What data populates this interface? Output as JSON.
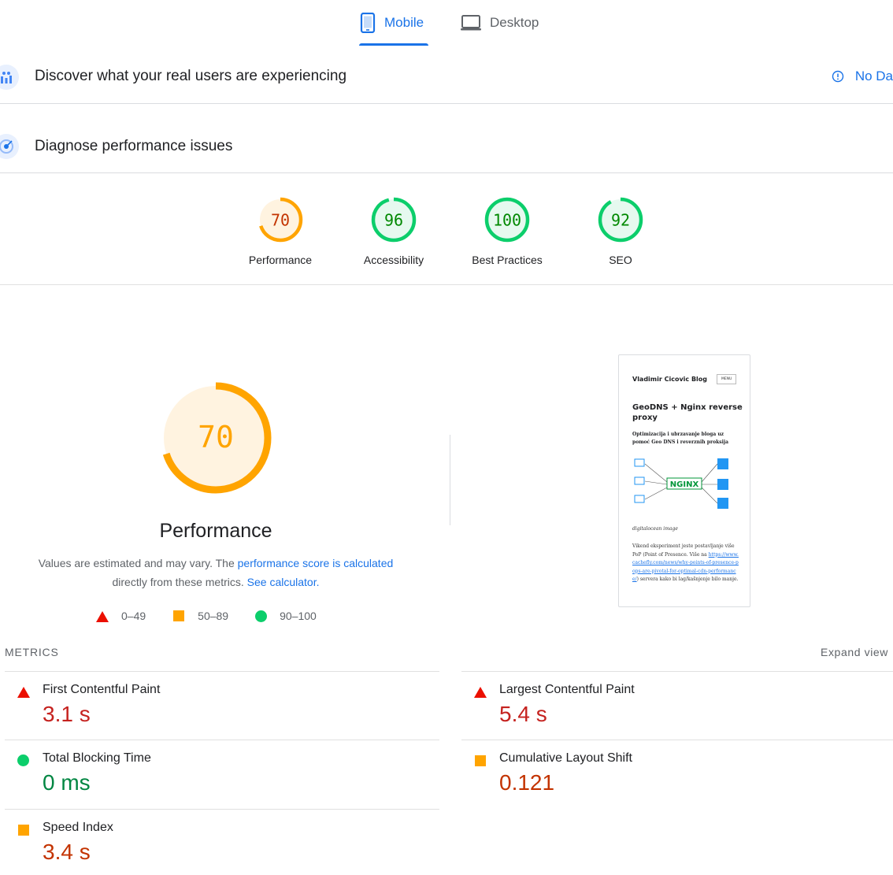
{
  "tabs": {
    "mobile": "Mobile",
    "desktop": "Desktop"
  },
  "sections": {
    "field": "Discover what your real users are experiencing",
    "field_status": "No Da",
    "lab": "Diagnose performance issues"
  },
  "scores": [
    {
      "label": "Performance",
      "value": "70",
      "score": 0.7,
      "color": "#ffa400"
    },
    {
      "label": "Accessibility",
      "value": "96",
      "score": 0.96,
      "color": "#0cce6b"
    },
    {
      "label": "Best Practices",
      "value": "100",
      "score": 1.0,
      "color": "#0cce6b"
    },
    {
      "label": "SEO",
      "value": "92",
      "score": 0.92,
      "color": "#0cce6b"
    }
  ],
  "performance": {
    "value": "70",
    "score": 0.7,
    "title": "Performance",
    "desc_prefix": "Values are estimated and may vary. The",
    "desc_link": "performance score is calculated",
    "desc_middle": "directly from these metrics.",
    "desc_link2": "See calculator."
  },
  "legend": [
    "0–49",
    "50–89",
    "90–100"
  ],
  "screenshot": {
    "blog_name": "Vladimir Cicovic Blog",
    "menu": "MENU",
    "post_title": "GeoDNS + Nginx reverse proxy",
    "post_sub": "Optimizacija i ubrzavanje bloga uz pomoć Geo DNS i reverznih proksija",
    "caption": "digitalocean image",
    "body_a": "Vikend eksperiment jeste postavljanje više PoP (Point of Presence. Više na",
    "body_link": "https://www.cachefly.com/news/why-points-of-presence-pops-are-pivotal-for-optimal-cdn-performance/",
    "body_b": ") servera kako bi lag/kašnjenje bilo manje."
  },
  "metrics_header": {
    "title": "METRICS",
    "expand": "Expand view"
  },
  "metrics": [
    {
      "label": "First Contentful Paint",
      "value": "3.1 s",
      "rating": "fail"
    },
    {
      "label": "Largest Contentful Paint",
      "value": "5.4 s",
      "rating": "fail"
    },
    {
      "label": "Total Blocking Time",
      "value": "0 ms",
      "rating": "pass"
    },
    {
      "label": "Cumulative Layout Shift",
      "value": "0.121",
      "rating": "average"
    },
    {
      "label": "Speed Index",
      "value": "3.4 s",
      "rating": "average"
    }
  ],
  "colors": {
    "accent": "#1a73e8",
    "fail": "#eb0f00",
    "average": "#ffa400",
    "pass": "#0cce6b"
  }
}
